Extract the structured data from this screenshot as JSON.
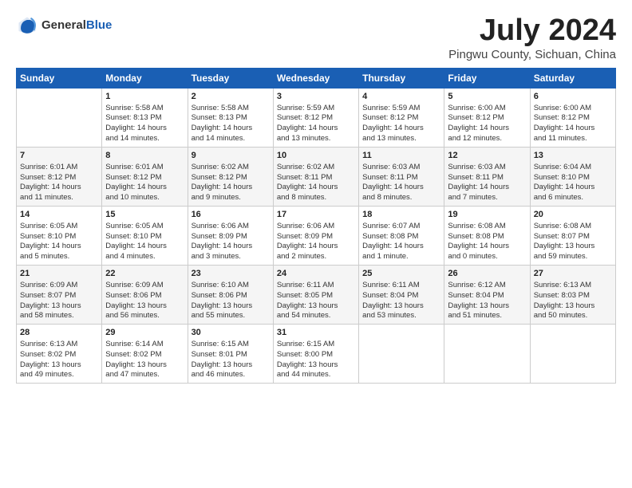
{
  "header": {
    "logo_general": "General",
    "logo_blue": "Blue",
    "month_title": "July 2024",
    "subtitle": "Pingwu County, Sichuan, China"
  },
  "weekdays": [
    "Sunday",
    "Monday",
    "Tuesday",
    "Wednesday",
    "Thursday",
    "Friday",
    "Saturday"
  ],
  "weeks": [
    [
      {
        "day": "",
        "info": ""
      },
      {
        "day": "1",
        "info": "Sunrise: 5:58 AM\nSunset: 8:13 PM\nDaylight: 14 hours\nand 14 minutes."
      },
      {
        "day": "2",
        "info": "Sunrise: 5:58 AM\nSunset: 8:13 PM\nDaylight: 14 hours\nand 14 minutes."
      },
      {
        "day": "3",
        "info": "Sunrise: 5:59 AM\nSunset: 8:12 PM\nDaylight: 14 hours\nand 13 minutes."
      },
      {
        "day": "4",
        "info": "Sunrise: 5:59 AM\nSunset: 8:12 PM\nDaylight: 14 hours\nand 13 minutes."
      },
      {
        "day": "5",
        "info": "Sunrise: 6:00 AM\nSunset: 8:12 PM\nDaylight: 14 hours\nand 12 minutes."
      },
      {
        "day": "6",
        "info": "Sunrise: 6:00 AM\nSunset: 8:12 PM\nDaylight: 14 hours\nand 11 minutes."
      }
    ],
    [
      {
        "day": "7",
        "info": "Sunrise: 6:01 AM\nSunset: 8:12 PM\nDaylight: 14 hours\nand 11 minutes."
      },
      {
        "day": "8",
        "info": "Sunrise: 6:01 AM\nSunset: 8:12 PM\nDaylight: 14 hours\nand 10 minutes."
      },
      {
        "day": "9",
        "info": "Sunrise: 6:02 AM\nSunset: 8:12 PM\nDaylight: 14 hours\nand 9 minutes."
      },
      {
        "day": "10",
        "info": "Sunrise: 6:02 AM\nSunset: 8:11 PM\nDaylight: 14 hours\nand 8 minutes."
      },
      {
        "day": "11",
        "info": "Sunrise: 6:03 AM\nSunset: 8:11 PM\nDaylight: 14 hours\nand 8 minutes."
      },
      {
        "day": "12",
        "info": "Sunrise: 6:03 AM\nSunset: 8:11 PM\nDaylight: 14 hours\nand 7 minutes."
      },
      {
        "day": "13",
        "info": "Sunrise: 6:04 AM\nSunset: 8:10 PM\nDaylight: 14 hours\nand 6 minutes."
      }
    ],
    [
      {
        "day": "14",
        "info": "Sunrise: 6:05 AM\nSunset: 8:10 PM\nDaylight: 14 hours\nand 5 minutes."
      },
      {
        "day": "15",
        "info": "Sunrise: 6:05 AM\nSunset: 8:10 PM\nDaylight: 14 hours\nand 4 minutes."
      },
      {
        "day": "16",
        "info": "Sunrise: 6:06 AM\nSunset: 8:09 PM\nDaylight: 14 hours\nand 3 minutes."
      },
      {
        "day": "17",
        "info": "Sunrise: 6:06 AM\nSunset: 8:09 PM\nDaylight: 14 hours\nand 2 minutes."
      },
      {
        "day": "18",
        "info": "Sunrise: 6:07 AM\nSunset: 8:08 PM\nDaylight: 14 hours\nand 1 minute."
      },
      {
        "day": "19",
        "info": "Sunrise: 6:08 AM\nSunset: 8:08 PM\nDaylight: 14 hours\nand 0 minutes."
      },
      {
        "day": "20",
        "info": "Sunrise: 6:08 AM\nSunset: 8:07 PM\nDaylight: 13 hours\nand 59 minutes."
      }
    ],
    [
      {
        "day": "21",
        "info": "Sunrise: 6:09 AM\nSunset: 8:07 PM\nDaylight: 13 hours\nand 58 minutes."
      },
      {
        "day": "22",
        "info": "Sunrise: 6:09 AM\nSunset: 8:06 PM\nDaylight: 13 hours\nand 56 minutes."
      },
      {
        "day": "23",
        "info": "Sunrise: 6:10 AM\nSunset: 8:06 PM\nDaylight: 13 hours\nand 55 minutes."
      },
      {
        "day": "24",
        "info": "Sunrise: 6:11 AM\nSunset: 8:05 PM\nDaylight: 13 hours\nand 54 minutes."
      },
      {
        "day": "25",
        "info": "Sunrise: 6:11 AM\nSunset: 8:04 PM\nDaylight: 13 hours\nand 53 minutes."
      },
      {
        "day": "26",
        "info": "Sunrise: 6:12 AM\nSunset: 8:04 PM\nDaylight: 13 hours\nand 51 minutes."
      },
      {
        "day": "27",
        "info": "Sunrise: 6:13 AM\nSunset: 8:03 PM\nDaylight: 13 hours\nand 50 minutes."
      }
    ],
    [
      {
        "day": "28",
        "info": "Sunrise: 6:13 AM\nSunset: 8:02 PM\nDaylight: 13 hours\nand 49 minutes."
      },
      {
        "day": "29",
        "info": "Sunrise: 6:14 AM\nSunset: 8:02 PM\nDaylight: 13 hours\nand 47 minutes."
      },
      {
        "day": "30",
        "info": "Sunrise: 6:15 AM\nSunset: 8:01 PM\nDaylight: 13 hours\nand 46 minutes."
      },
      {
        "day": "31",
        "info": "Sunrise: 6:15 AM\nSunset: 8:00 PM\nDaylight: 13 hours\nand 44 minutes."
      },
      {
        "day": "",
        "info": ""
      },
      {
        "day": "",
        "info": ""
      },
      {
        "day": "",
        "info": ""
      }
    ]
  ]
}
